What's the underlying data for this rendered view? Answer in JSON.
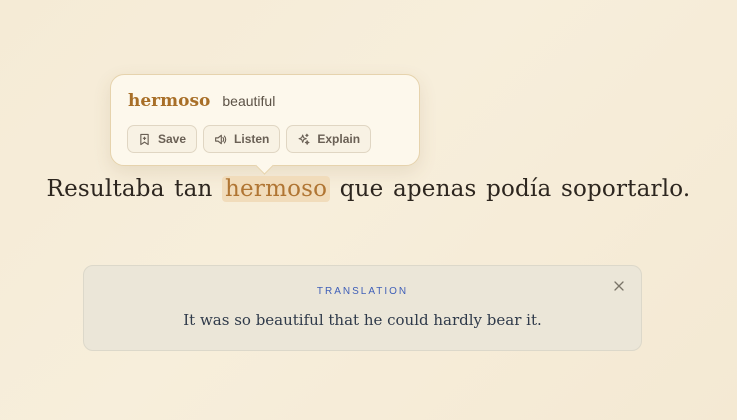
{
  "popover": {
    "word": "hermoso",
    "gloss": "beautiful",
    "actions": [
      {
        "label": "Save",
        "icon": "bookmark-icon"
      },
      {
        "label": "Listen",
        "icon": "speaker-icon"
      },
      {
        "label": "Explain",
        "icon": "sparkle-icon"
      }
    ]
  },
  "sentence": {
    "words": [
      "Resultaba",
      "tan",
      "hermoso",
      "que",
      "apenas",
      "podía",
      "soportarlo."
    ],
    "highlighted_index": 2
  },
  "translation": {
    "label": "TRANSLATION",
    "text": "It was so beautiful that he could hardly bear it.",
    "close_icon": "close-icon"
  },
  "colors": {
    "accent": "#a86f28",
    "highlight_bg": "#f1dcbb",
    "translation_label": "#3f5fb8",
    "background": "#f5ebd6"
  }
}
